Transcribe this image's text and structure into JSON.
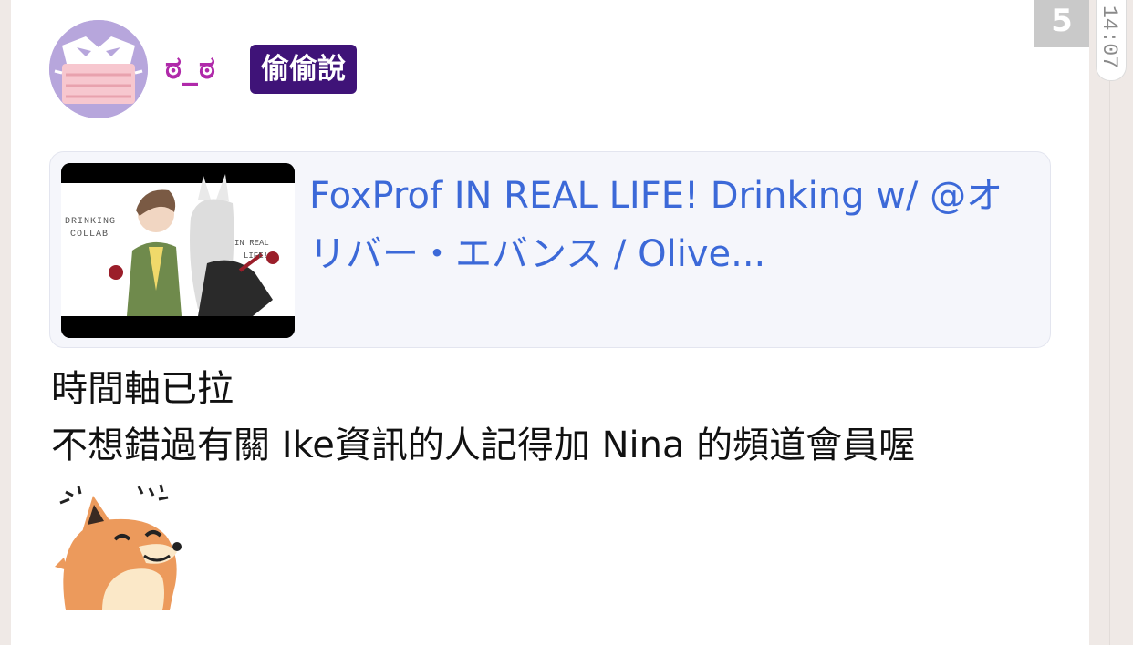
{
  "author": {
    "name": "ಠ_ಠ",
    "tag": "偷偷說",
    "avatar_icon": "masked-face-avatar-icon"
  },
  "reply_count": "5",
  "timestamp": "14:07",
  "link_preview": {
    "title": "FoxProf IN REAL LIFE! Drinking w/ @オリバー・エバンス / Olive...",
    "thumbnail": {
      "left_text": "DRINKING COLLAB",
      "right_text": "IN REAL LIFE!"
    }
  },
  "message": {
    "line1": "時間軸已拉",
    "line2": "不想錯過有關 Ike資訊的人記得加 Nina 的頻道會員喔"
  },
  "sticker": {
    "icon": "smiling-fox-sticker-icon"
  },
  "colors": {
    "username": "#b02aaa",
    "tag_bg": "#3f1378",
    "link": "#3c69d8",
    "avatar_bg": "#b7a6dc"
  }
}
